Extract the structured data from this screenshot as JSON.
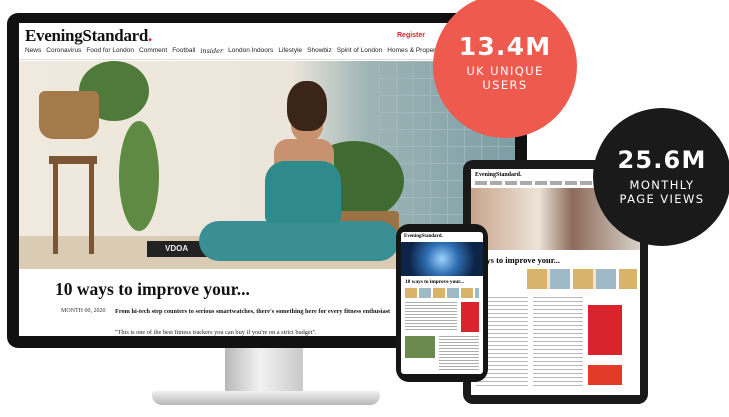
{
  "desktop": {
    "logo": "EveningStandard",
    "logo_dot": ".",
    "register": "Register",
    "nav": [
      "News",
      "Coronavirus",
      "Food for London",
      "Comment",
      "Football",
      "insider",
      "London Indoors",
      "Lifestyle",
      "Showbiz",
      "Spirit of London",
      "Homes & Property"
    ],
    "hero_book_text": "VDOA",
    "headline": "10 ways to improve your...",
    "date": "MONTH 00, 2020",
    "standfirst": "From hi-tech step counters to serious smartwatches, there's something here for every fitness enthusiast",
    "quote": "\"This is one of the best fitness trackers you can buy if you're on a strict budget\"."
  },
  "tablet": {
    "logo": "EveningStandard.",
    "headline": "ways to improve your..."
  },
  "phone": {
    "logo": "EveningStandard.",
    "headline": "10 ways to improve your..."
  },
  "stats": {
    "unique_users": {
      "value": "13.4M",
      "label_line1": "UK UNIQUE",
      "label_line2": "USERS",
      "color": "#ef5a4f"
    },
    "page_views": {
      "value": "25.6M",
      "label_line1": "MONTHLY",
      "label_line2": "PAGE VIEWS",
      "color": "#1a1a1a"
    }
  }
}
